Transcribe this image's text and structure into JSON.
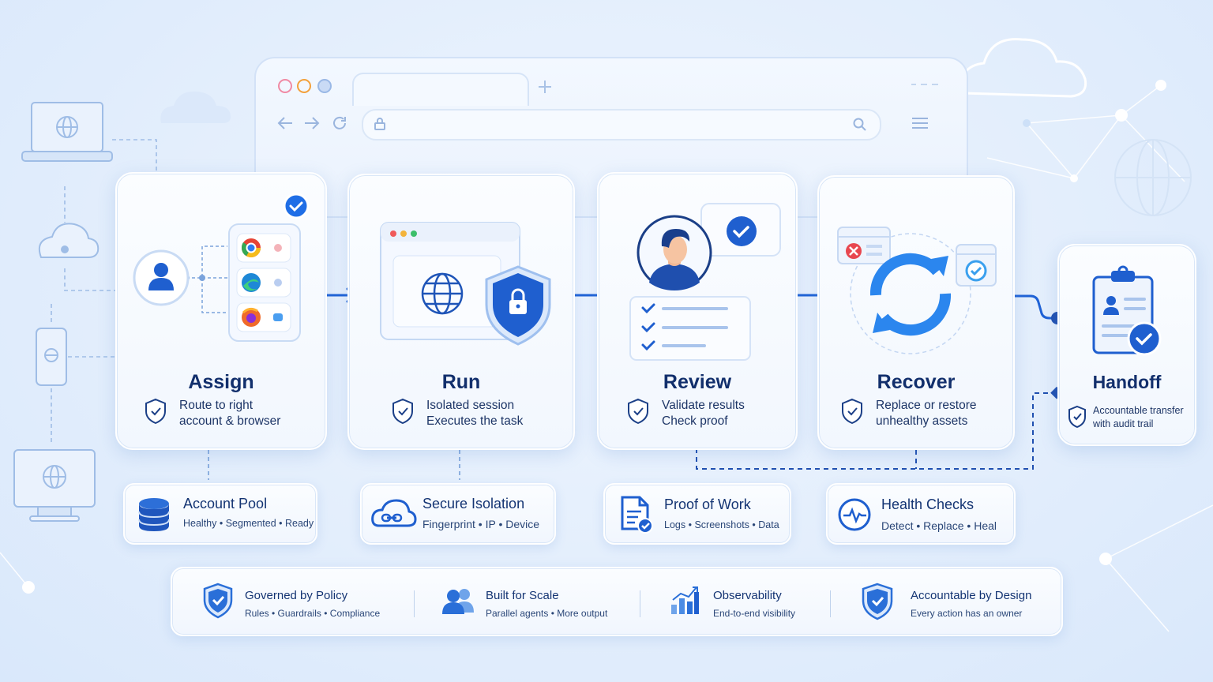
{
  "steps": [
    {
      "title": "Assign",
      "desc1": "Route to right",
      "desc2": "account & browser"
    },
    {
      "title": "Run",
      "desc1": "Isolated session",
      "desc2": "Executes the task"
    },
    {
      "title": "Review",
      "desc1": "Validate results",
      "desc2": "Check proof"
    },
    {
      "title": "Recover",
      "desc1": "Replace or restore",
      "desc2": "unhealthy assets"
    },
    {
      "title": "Handoff",
      "desc1": "Accountable transfer",
      "desc2": "with audit trail"
    }
  ],
  "info_boxes": [
    {
      "title": "Account Pool",
      "sub": [
        "Healthy",
        "Segmented",
        "Ready"
      ],
      "icon": "database-icon"
    },
    {
      "title": "Secure Isolation",
      "sub": [
        "Fingerprint",
        "IP",
        "Device"
      ],
      "icon": "cloud-link-icon"
    },
    {
      "title": "Proof of Work",
      "sub": [
        "Logs",
        "Screenshots",
        "Data"
      ],
      "icon": "document-check-icon"
    },
    {
      "title": "Health Checks",
      "sub": [
        "Detect",
        "Replace",
        "Heal"
      ],
      "icon": "heartbeat-icon"
    }
  ],
  "principles": [
    {
      "title": "Governed by Policy",
      "sub": "Rules • Guardrails • Compliance",
      "icon": "shield-check-icon"
    },
    {
      "title": "Built for Scale",
      "sub": "Parallel agents • More output",
      "icon": "users-icon"
    },
    {
      "title": "Observability",
      "sub": "End-to-end visibility",
      "icon": "bar-chart-icon"
    },
    {
      "title": "Accountable by Design",
      "sub": "Every action has an owner",
      "icon": "shield-check-icon"
    }
  ],
  "colors": {
    "primary": "#1f62d6",
    "accent": "#2f86f0",
    "navy": "#122f6c",
    "light": "#e3eefc"
  }
}
